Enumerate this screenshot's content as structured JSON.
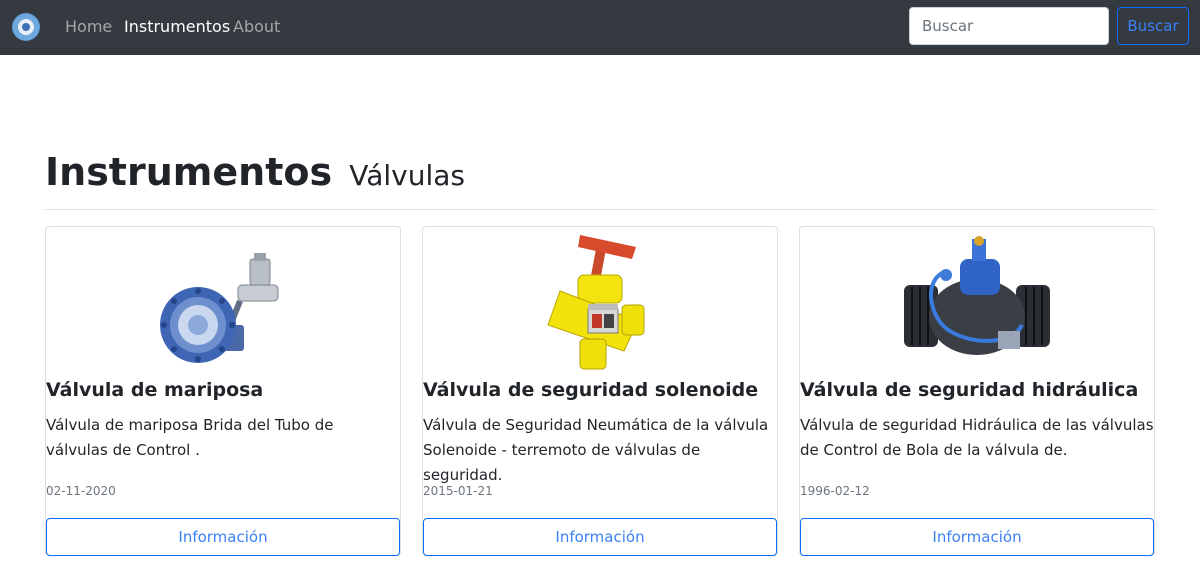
{
  "navbar": {
    "brand_icon": "brand-logo-icon",
    "links": [
      {
        "label": "Home",
        "active": false
      },
      {
        "label": "Instrumentos",
        "active": true
      },
      {
        "label": "About",
        "active": false
      }
    ],
    "search": {
      "placeholder": "Buscar",
      "value": "",
      "button_label": "Buscar"
    }
  },
  "heading": {
    "title": "Instrumentos",
    "subtitle": "Válvulas"
  },
  "cards": [
    {
      "image_icon": "butterfly-valve-image",
      "title": "Válvula de mariposa",
      "text": "Válvula de mariposa Brida del Tubo de válvulas de Control .",
      "date": "02-11-2020",
      "button_label": "Información"
    },
    {
      "image_icon": "solenoid-safety-valve-image",
      "title": "Válvula de seguridad solenoide",
      "text": "Válvula de Seguridad Neumática de la válvula Solenoide - terremoto de válvulas de seguridad.",
      "date": "2015-01-21",
      "button_label": "Información"
    },
    {
      "image_icon": "hydraulic-safety-valve-image",
      "title": "Válvula de seguridad hidráulica",
      "text": "Válvula de seguridad Hidráulica de las válvulas de Control de Bola de la válvula de.",
      "date": "1996-02-12",
      "button_label": "Información"
    }
  ],
  "colors": {
    "navbar_bg": "#343a40",
    "primary": "#0d6efd",
    "text": "#212529",
    "muted": "#6c757d"
  }
}
